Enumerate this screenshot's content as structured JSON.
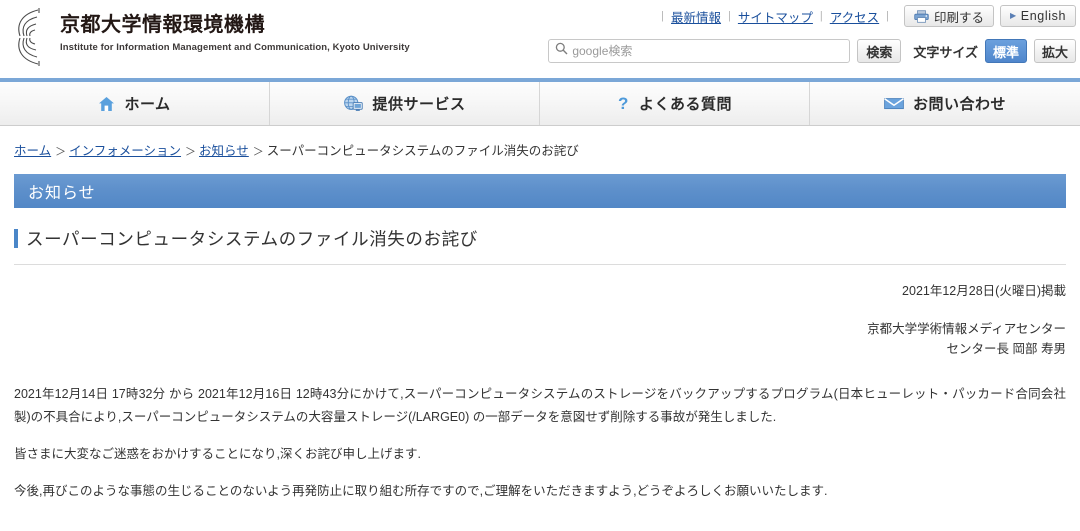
{
  "header": {
    "logo_icon": "radiating-wave-logo",
    "org_name": "京都大学情報環境機構",
    "org_name_en": "Institute for Information Management and Communication, Kyoto University",
    "util_links": [
      {
        "label": "最新情報"
      },
      {
        "label": "サイトマップ"
      },
      {
        "label": "アクセス"
      }
    ],
    "print_button": "印刷する",
    "print_icon": "printer-icon",
    "english_button": "English",
    "search": {
      "placeholder": "google検索",
      "value": "",
      "icon": "search-icon",
      "submit_label": "検索"
    },
    "font_size": {
      "label": "文字サイズ",
      "options": [
        {
          "label": "標準",
          "active": true
        },
        {
          "label": "拡大",
          "active": false
        }
      ]
    }
  },
  "mainnav": [
    {
      "label": "ホーム",
      "icon": "home-icon"
    },
    {
      "label": "提供サービス",
      "icon": "globe-monitor-icon"
    },
    {
      "label": "よくある質問",
      "icon": "question-mark-icon"
    },
    {
      "label": "お問い合わせ",
      "icon": "envelope-icon"
    }
  ],
  "breadcrumb": [
    {
      "label": "ホーム",
      "link": true
    },
    {
      "label": "インフォメーション",
      "link": true
    },
    {
      "label": "お知らせ",
      "link": true
    },
    {
      "label": "スーパーコンピュータシステムのファイル消失のお詫び",
      "link": false
    }
  ],
  "breadcrumb_separator": "＞",
  "main": {
    "section_banner": "お知らせ",
    "page_title": "スーパーコンピュータシステムのファイル消失のお詫び",
    "published": "2021年12月28日(火曜日)掲載",
    "author_org": "京都大学学術情報メディアセンター",
    "author_name": "センター長 岡部 寿男",
    "paragraphs": [
      "2021年12月14日 17時32分 から 2021年12月16日 12時43分にかけて,スーパーコンピュータシステムのストレージをバックアップするプログラム(日本ヒューレット・パッカード合同会社製)の不具合により,スーパーコンピュータシステムの大容量ストレージ(/LARGE0) の一部データを意図せず削除する事故が発生しました.",
      "皆さまに大変なご迷惑をおかけすることになり,深くお詫び申し上げます.",
      "今後,再びこのような事態の生じることのないよう再発防止に取り組む所存ですので,ご理解をいただきますよう,どうぞよろしくお願いいたします."
    ]
  },
  "colors": {
    "brand_blue": "#5b93d6",
    "nav_top_border": "#7ba7d7",
    "banner_blue": "#5e90cb",
    "link_blue": "#1a4f9c",
    "title_bar": "#4a86c8"
  }
}
